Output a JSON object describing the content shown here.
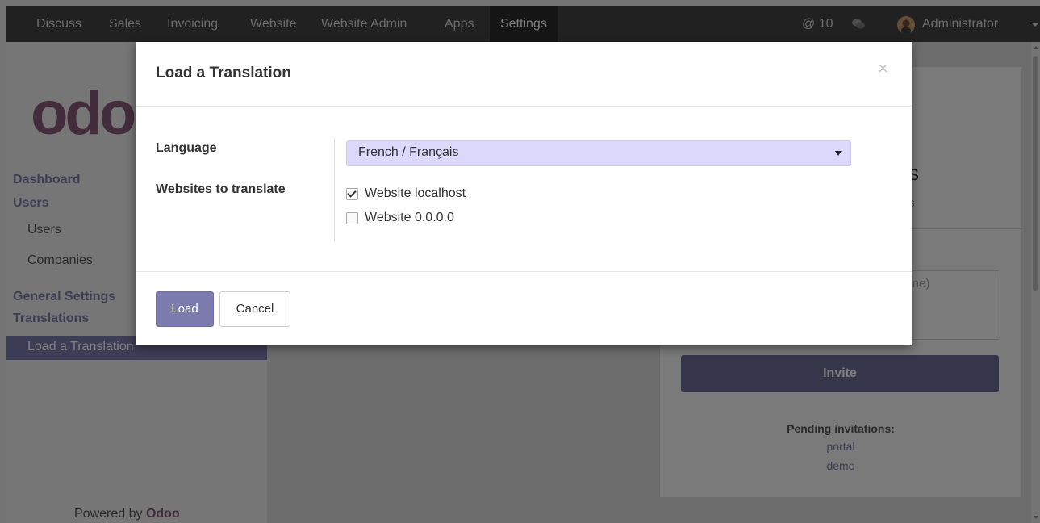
{
  "navbar": {
    "menu": [
      "Discuss",
      "Sales",
      "Invoicing",
      "Website",
      "Website Admin",
      "Apps",
      "Settings"
    ],
    "active_menu": "Settings",
    "messages_count": "@ 10",
    "user_name": "Administrator",
    "icons": {
      "chat": "chat-icon",
      "avatar": "avatar",
      "caret": "caret-down-icon"
    }
  },
  "sidebar": {
    "logo_text": "odoo",
    "section_dashboard": "Dashboard",
    "section_users": "Users",
    "items_users": [
      "Users",
      "Companies"
    ],
    "section_general": "General Settings",
    "section_translations": "Translations",
    "active_item": "Load a Translation",
    "powered_prefix": "Powered by",
    "powered_brand": "Odoo"
  },
  "background_card": {
    "title_fragment": "s",
    "subtitle_fragment": "s",
    "textarea_placeholder_fragment": "line)",
    "invite_label": "Invite",
    "pending_label": "Pending invitations:",
    "pending_users": [
      "portal",
      "demo"
    ]
  },
  "modal": {
    "title": "Load a Translation",
    "close_glyph": "×",
    "language_label": "Language",
    "language_value": "French / Français",
    "websites_label": "Websites to translate",
    "websites": [
      {
        "label": "Website localhost",
        "checked": true
      },
      {
        "label": "Website 0.0.0.0",
        "checked": false
      }
    ],
    "load_label": "Load",
    "cancel_label": "Cancel"
  },
  "colors": {
    "brand": "#875a7b",
    "accent": "#7c7bad",
    "navbar": "#434343",
    "select_bg": "#dcd8fb"
  }
}
